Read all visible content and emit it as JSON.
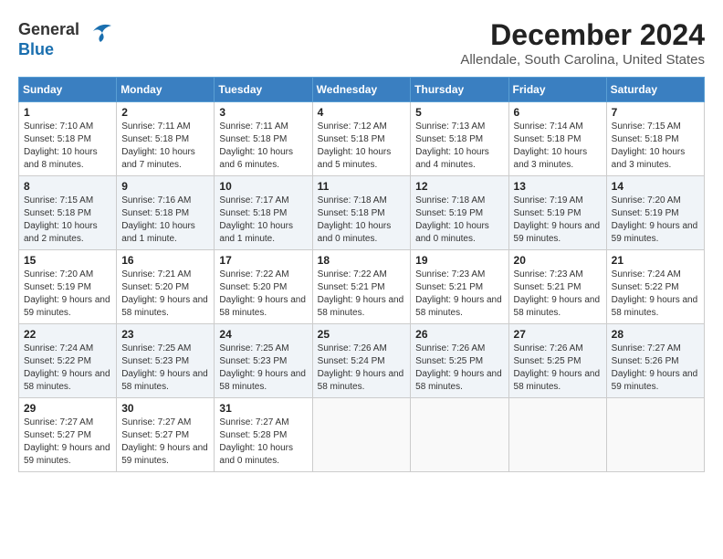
{
  "header": {
    "logo_line1": "General",
    "logo_line2": "Blue",
    "month": "December 2024",
    "location": "Allendale, South Carolina, United States"
  },
  "days_of_week": [
    "Sunday",
    "Monday",
    "Tuesday",
    "Wednesday",
    "Thursday",
    "Friday",
    "Saturday"
  ],
  "weeks": [
    [
      {
        "day": "1",
        "sunrise": "Sunrise: 7:10 AM",
        "sunset": "Sunset: 5:18 PM",
        "daylight": "Daylight: 10 hours and 8 minutes."
      },
      {
        "day": "2",
        "sunrise": "Sunrise: 7:11 AM",
        "sunset": "Sunset: 5:18 PM",
        "daylight": "Daylight: 10 hours and 7 minutes."
      },
      {
        "day": "3",
        "sunrise": "Sunrise: 7:11 AM",
        "sunset": "Sunset: 5:18 PM",
        "daylight": "Daylight: 10 hours and 6 minutes."
      },
      {
        "day": "4",
        "sunrise": "Sunrise: 7:12 AM",
        "sunset": "Sunset: 5:18 PM",
        "daylight": "Daylight: 10 hours and 5 minutes."
      },
      {
        "day": "5",
        "sunrise": "Sunrise: 7:13 AM",
        "sunset": "Sunset: 5:18 PM",
        "daylight": "Daylight: 10 hours and 4 minutes."
      },
      {
        "day": "6",
        "sunrise": "Sunrise: 7:14 AM",
        "sunset": "Sunset: 5:18 PM",
        "daylight": "Daylight: 10 hours and 3 minutes."
      },
      {
        "day": "7",
        "sunrise": "Sunrise: 7:15 AM",
        "sunset": "Sunset: 5:18 PM",
        "daylight": "Daylight: 10 hours and 3 minutes."
      }
    ],
    [
      {
        "day": "8",
        "sunrise": "Sunrise: 7:15 AM",
        "sunset": "Sunset: 5:18 PM",
        "daylight": "Daylight: 10 hours and 2 minutes."
      },
      {
        "day": "9",
        "sunrise": "Sunrise: 7:16 AM",
        "sunset": "Sunset: 5:18 PM",
        "daylight": "Daylight: 10 hours and 1 minute."
      },
      {
        "day": "10",
        "sunrise": "Sunrise: 7:17 AM",
        "sunset": "Sunset: 5:18 PM",
        "daylight": "Daylight: 10 hours and 1 minute."
      },
      {
        "day": "11",
        "sunrise": "Sunrise: 7:18 AM",
        "sunset": "Sunset: 5:18 PM",
        "daylight": "Daylight: 10 hours and 0 minutes."
      },
      {
        "day": "12",
        "sunrise": "Sunrise: 7:18 AM",
        "sunset": "Sunset: 5:19 PM",
        "daylight": "Daylight: 10 hours and 0 minutes."
      },
      {
        "day": "13",
        "sunrise": "Sunrise: 7:19 AM",
        "sunset": "Sunset: 5:19 PM",
        "daylight": "Daylight: 9 hours and 59 minutes."
      },
      {
        "day": "14",
        "sunrise": "Sunrise: 7:20 AM",
        "sunset": "Sunset: 5:19 PM",
        "daylight": "Daylight: 9 hours and 59 minutes."
      }
    ],
    [
      {
        "day": "15",
        "sunrise": "Sunrise: 7:20 AM",
        "sunset": "Sunset: 5:19 PM",
        "daylight": "Daylight: 9 hours and 59 minutes."
      },
      {
        "day": "16",
        "sunrise": "Sunrise: 7:21 AM",
        "sunset": "Sunset: 5:20 PM",
        "daylight": "Daylight: 9 hours and 58 minutes."
      },
      {
        "day": "17",
        "sunrise": "Sunrise: 7:22 AM",
        "sunset": "Sunset: 5:20 PM",
        "daylight": "Daylight: 9 hours and 58 minutes."
      },
      {
        "day": "18",
        "sunrise": "Sunrise: 7:22 AM",
        "sunset": "Sunset: 5:21 PM",
        "daylight": "Daylight: 9 hours and 58 minutes."
      },
      {
        "day": "19",
        "sunrise": "Sunrise: 7:23 AM",
        "sunset": "Sunset: 5:21 PM",
        "daylight": "Daylight: 9 hours and 58 minutes."
      },
      {
        "day": "20",
        "sunrise": "Sunrise: 7:23 AM",
        "sunset": "Sunset: 5:21 PM",
        "daylight": "Daylight: 9 hours and 58 minutes."
      },
      {
        "day": "21",
        "sunrise": "Sunrise: 7:24 AM",
        "sunset": "Sunset: 5:22 PM",
        "daylight": "Daylight: 9 hours and 58 minutes."
      }
    ],
    [
      {
        "day": "22",
        "sunrise": "Sunrise: 7:24 AM",
        "sunset": "Sunset: 5:22 PM",
        "daylight": "Daylight: 9 hours and 58 minutes."
      },
      {
        "day": "23",
        "sunrise": "Sunrise: 7:25 AM",
        "sunset": "Sunset: 5:23 PM",
        "daylight": "Daylight: 9 hours and 58 minutes."
      },
      {
        "day": "24",
        "sunrise": "Sunrise: 7:25 AM",
        "sunset": "Sunset: 5:23 PM",
        "daylight": "Daylight: 9 hours and 58 minutes."
      },
      {
        "day": "25",
        "sunrise": "Sunrise: 7:26 AM",
        "sunset": "Sunset: 5:24 PM",
        "daylight": "Daylight: 9 hours and 58 minutes."
      },
      {
        "day": "26",
        "sunrise": "Sunrise: 7:26 AM",
        "sunset": "Sunset: 5:25 PM",
        "daylight": "Daylight: 9 hours and 58 minutes."
      },
      {
        "day": "27",
        "sunrise": "Sunrise: 7:26 AM",
        "sunset": "Sunset: 5:25 PM",
        "daylight": "Daylight: 9 hours and 58 minutes."
      },
      {
        "day": "28",
        "sunrise": "Sunrise: 7:27 AM",
        "sunset": "Sunset: 5:26 PM",
        "daylight": "Daylight: 9 hours and 59 minutes."
      }
    ],
    [
      {
        "day": "29",
        "sunrise": "Sunrise: 7:27 AM",
        "sunset": "Sunset: 5:27 PM",
        "daylight": "Daylight: 9 hours and 59 minutes."
      },
      {
        "day": "30",
        "sunrise": "Sunrise: 7:27 AM",
        "sunset": "Sunset: 5:27 PM",
        "daylight": "Daylight: 9 hours and 59 minutes."
      },
      {
        "day": "31",
        "sunrise": "Sunrise: 7:27 AM",
        "sunset": "Sunset: 5:28 PM",
        "daylight": "Daylight: 10 hours and 0 minutes."
      },
      {
        "day": "",
        "sunrise": "",
        "sunset": "",
        "daylight": ""
      },
      {
        "day": "",
        "sunrise": "",
        "sunset": "",
        "daylight": ""
      },
      {
        "day": "",
        "sunrise": "",
        "sunset": "",
        "daylight": ""
      },
      {
        "day": "",
        "sunrise": "",
        "sunset": "",
        "daylight": ""
      }
    ]
  ]
}
